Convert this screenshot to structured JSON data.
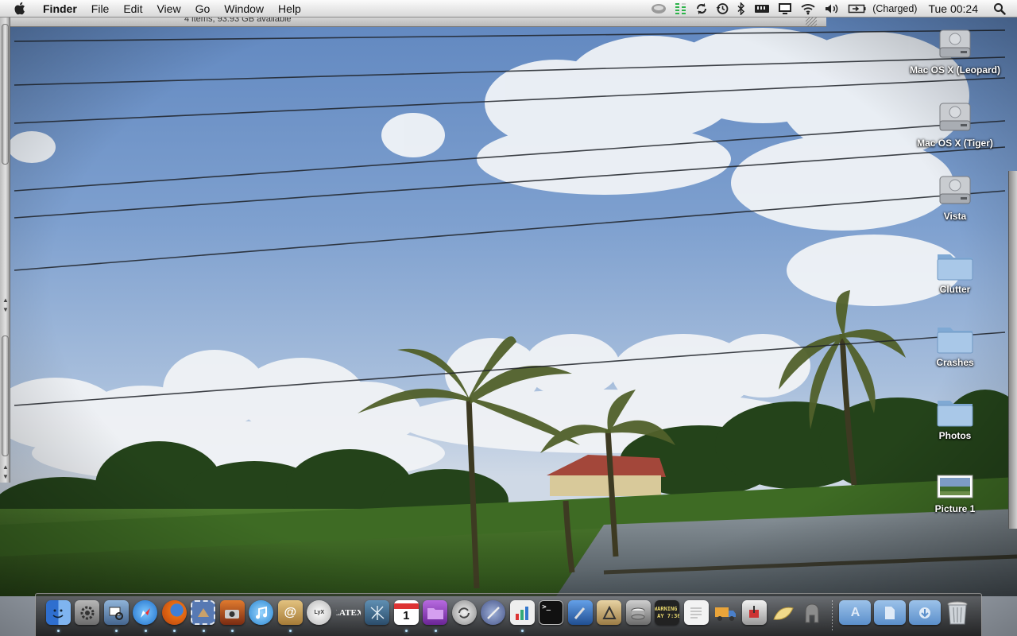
{
  "menubar": {
    "app_name": "Finder",
    "menus": [
      "File",
      "Edit",
      "View",
      "Go",
      "Window",
      "Help"
    ],
    "battery_status": "(Charged)",
    "clock": "Tue 00:24"
  },
  "background_window": {
    "status_text": "4 items, 93.93 GB available"
  },
  "desktop": {
    "icons": [
      {
        "label": "Mac OS X (Leopard)",
        "icon": "hard-drive-icon"
      },
      {
        "label": "Mac OS X (Tiger)",
        "icon": "hard-drive-icon"
      },
      {
        "label": "Vista",
        "icon": "hard-drive-icon"
      },
      {
        "label": "Clutter",
        "icon": "folder-icon"
      },
      {
        "label": "Crashes",
        "icon": "folder-icon"
      },
      {
        "label": "Photos",
        "icon": "folder-icon"
      },
      {
        "label": "Picture 1",
        "icon": "image-file-icon"
      }
    ]
  },
  "dock": {
    "apps": [
      {
        "name": "finder",
        "color": "#3b7fd6",
        "running": true
      },
      {
        "name": "system-preferences",
        "color": "#8c8c8c",
        "running": false
      },
      {
        "name": "preview",
        "color": "#5d7fa8",
        "running": true
      },
      {
        "name": "safari",
        "color": "#2f8de4",
        "running": true
      },
      {
        "name": "firefox",
        "color": "#e86c16",
        "running": true
      },
      {
        "name": "mail-stamp",
        "color": "#4a6fa8",
        "running": true
      },
      {
        "name": "photo-booth",
        "color": "#b3541e",
        "running": true
      },
      {
        "name": "itunes",
        "color": "#3fa9e6",
        "running": false
      },
      {
        "name": "address-book",
        "color": "#c89a4e",
        "running": true
      },
      {
        "name": "lyx",
        "color": "#d9d9d9",
        "running": false
      },
      {
        "name": "latex",
        "color": "#6b6b6b",
        "running": false
      },
      {
        "name": "net-tool",
        "color": "#3d6b8d",
        "running": false
      },
      {
        "name": "ical",
        "color": "#ffffff",
        "running": true
      },
      {
        "name": "omnifocus",
        "color": "#8a3fb8",
        "running": true
      },
      {
        "name": "sync",
        "color": "#9a9a9a",
        "running": false
      },
      {
        "name": "script-editor",
        "color": "#5b6ea8",
        "running": false
      },
      {
        "name": "grapher",
        "color": "#d94c3b",
        "running": true
      },
      {
        "name": "terminal",
        "color": "#1a1a1a",
        "running": false
      },
      {
        "name": "xcode",
        "color": "#3a7fd1",
        "running": false
      },
      {
        "name": "interface-builder",
        "color": "#c9a86b",
        "running": false
      },
      {
        "name": "disk-utility",
        "color": "#8a8a8a",
        "running": false
      },
      {
        "name": "console",
        "color": "#2a2a2a",
        "running": false
      },
      {
        "name": "text-edit",
        "color": "#e8e8e8",
        "running": false
      },
      {
        "name": "transmit",
        "color": "#d98c2a",
        "running": false
      },
      {
        "name": "installer",
        "color": "#b33a3a",
        "running": false
      },
      {
        "name": "taco",
        "color": "#e8d68a",
        "running": false
      },
      {
        "name": "spartan",
        "color": "#7a7a7a",
        "running": false
      }
    ],
    "stacks": [
      {
        "name": "applications-stack"
      },
      {
        "name": "documents-stack"
      },
      {
        "name": "downloads-stack"
      },
      {
        "name": "trash"
      }
    ],
    "console_text": "WARNING\n AY 7:36"
  }
}
